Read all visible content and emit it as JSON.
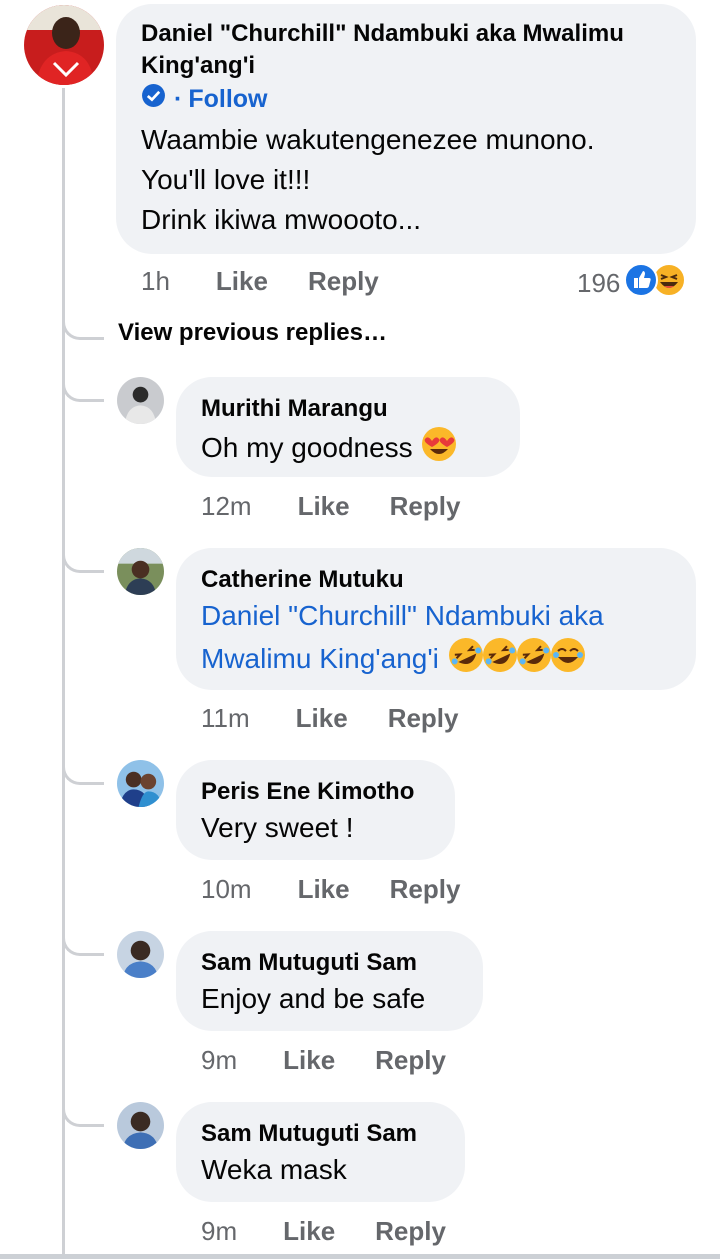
{
  "main_comment": {
    "author_line1": "Daniel \"Churchill\" Ndambuki aka Mwalimu",
    "author_line2": "King'ang'i",
    "verified_icon": "verified-badge-icon",
    "follow_dot": "·",
    "follow_label": "Follow",
    "lines": [
      "Waambie wakutengenezee munono.",
      "You'll love it!!!",
      "Drink ikiwa mwoooto..."
    ],
    "time": "1h",
    "like_label": "Like",
    "reply_label": "Reply",
    "reaction_count": "196",
    "reaction_icons": [
      "like-reaction-icon",
      "haha-reaction-icon"
    ],
    "colors": {
      "avatar_bg": "#d32020",
      "accent": "#1763cf"
    }
  },
  "view_previous_label": "View previous replies…",
  "replies": [
    {
      "author": "Murithi Marangu",
      "text": "Oh my goodness",
      "emoji": "heart-eyes-emoji",
      "time": "12m",
      "like_label": "Like",
      "reply_label": "Reply"
    },
    {
      "author": "Catherine Mutuku",
      "mention_line1": "Daniel \"Churchill\" Ndambuki aka",
      "mention_line2": "Mwalimu King'ang'i",
      "emoji": [
        "rofl-emoji",
        "rofl-emoji",
        "rofl-emoji",
        "joy-emoji"
      ],
      "time": "11m",
      "like_label": "Like",
      "reply_label": "Reply"
    },
    {
      "author": "Peris Ene Kimotho",
      "text": "Very sweet !",
      "time": "10m",
      "like_label": "Like",
      "reply_label": "Reply"
    },
    {
      "author": "Sam Mutuguti Sam",
      "text": "Enjoy and be safe",
      "time": "9m",
      "like_label": "Like",
      "reply_label": "Reply"
    },
    {
      "author": "Sam Mutuguti Sam",
      "text": "Weka mask",
      "time": "9m",
      "like_label": "Like",
      "reply_label": "Reply"
    }
  ]
}
